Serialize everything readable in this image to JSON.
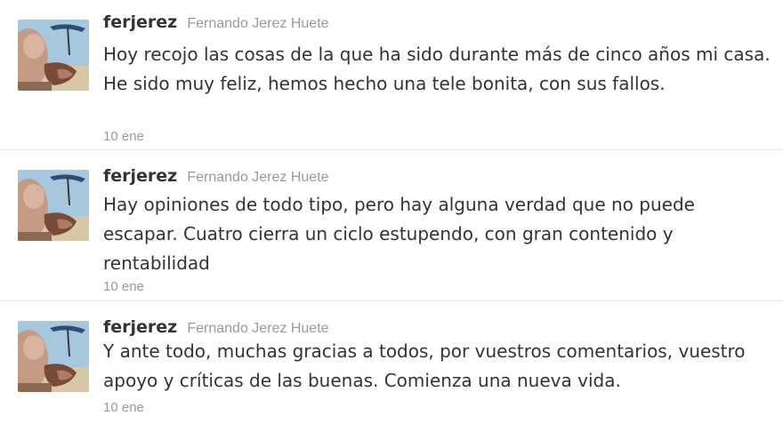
{
  "tweets": [
    {
      "screen_name": "ferjerez",
      "full_name": "Fernando Jerez Huete",
      "text": "Hoy recojo las cosas de la que ha sido durante más de cinco años mi casa. He sido muy feliz, hemos hecho una tele bonita, con sus fallos.",
      "time": "10 ene",
      "avatar_icon": "profile-photo"
    },
    {
      "screen_name": "ferjerez",
      "full_name": "Fernando Jerez Huete",
      "text": "Hay opiniones de todo tipo, pero hay alguna verdad que no puede escapar. Cuatro cierra un ciclo estupendo, con gran contenido y rentabilidad",
      "time": "10 ene",
      "avatar_icon": "profile-photo"
    },
    {
      "screen_name": "ferjerez",
      "full_name": "Fernando Jerez Huete",
      "text": "Y ante todo, muchas gracias a todos, por vuestros comentarios, vuestro apoyo y críticas de las buenas. Comienza una nueva vida.",
      "time": "10 ene",
      "avatar_icon": "profile-photo"
    }
  ],
  "colors": {
    "text": "#333333",
    "muted": "#999999",
    "divider": "#e6e6e6"
  }
}
